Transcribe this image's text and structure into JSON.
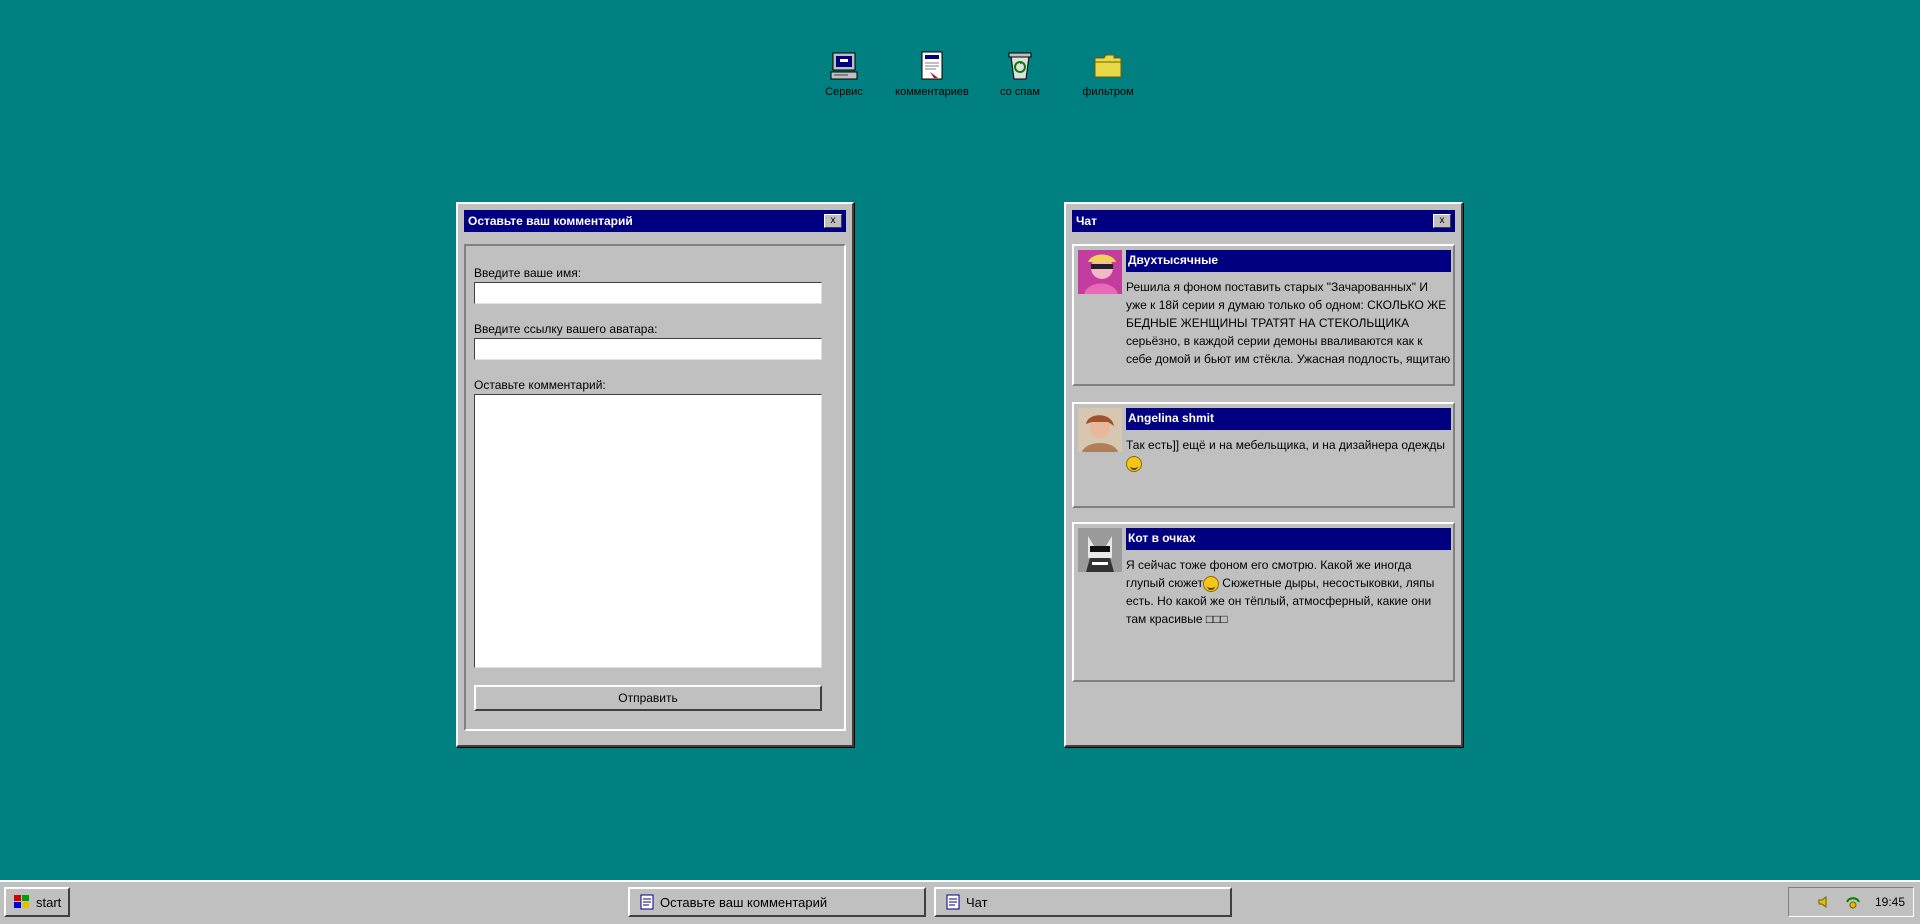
{
  "desktop": {
    "icons": [
      {
        "label": "Сервис",
        "icon": "computer-icon"
      },
      {
        "label": "комментариев",
        "icon": "document-icon"
      },
      {
        "label": "со спам",
        "icon": "recycle-bin-icon"
      },
      {
        "label": "фильтром",
        "icon": "folder-icon"
      }
    ]
  },
  "comment_window": {
    "title": "Оставьте ваш комментарий",
    "close_label": "x",
    "name_label": "Введите ваше имя:",
    "name_value": "",
    "avatar_label": "Введите ссылку вашего аватара:",
    "avatar_value": "",
    "comment_label": "Оставьте комментарий:",
    "comment_value": "",
    "submit_label": "Отправить"
  },
  "chat_window": {
    "title": "Чат",
    "close_label": "x",
    "messages": [
      {
        "author": "Двухтысячные",
        "text": "Решила я фоном поставить старых \"Зачарованных\" И уже к 18й серии я думаю только об одном: СКОЛЬКО ЖЕ БЕДНЫЕ ЖЕНЩИНЫ ТРАТЯТ НА СТЕКОЛЬЩИКА серьёзно, в каждой серии демоны вваливаются как к себе домой и бьют им стёкла. Ужасная подлость, ящитаю"
      },
      {
        "author": "Angelina shmit",
        "text": "Так есть]] ещё и на мебельщика, и на дизайнера одежды"
      },
      {
        "author": "Кот в очках",
        "text_part1": "Я сейчас тоже фоном его смотрю. Какой же иногда глупый сюжет",
        "text_part2": " Сюжетные дыры, несостыковки, ляпы есть. Но какой же он тёплый, атмосферный, какие они там красивые □□□"
      }
    ]
  },
  "taskbar": {
    "start_label": "start",
    "tasks": [
      "Оставьте ваш комментарий",
      "Чат"
    ],
    "clock": "19:45"
  },
  "colors": {
    "desktop": "#008080",
    "titlebar": "#000080",
    "window": "#c0c0c0"
  }
}
